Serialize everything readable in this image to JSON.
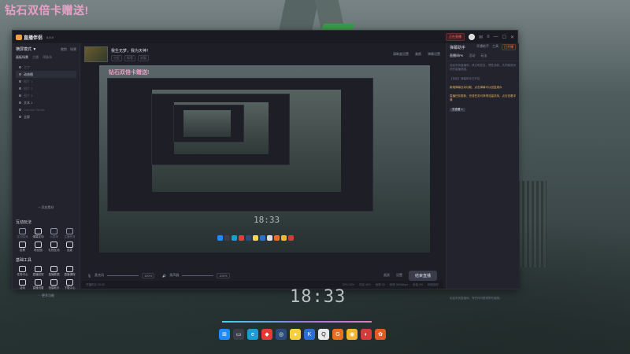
{
  "overlay_watermark": "钻石双倍卡赠送!",
  "desktop_clock": "18:33",
  "app": {
    "name": "直播伴侣",
    "version": "8.5.0",
    "live_badge": "正在直播",
    "sidebar": {
      "mode": "横屏模式 ▼",
      "actions": [
        "裁剪",
        "场景"
      ],
      "tabs": [
        "画板场景",
        "主播",
        "预备场"
      ],
      "scenes": [
        "文字",
        "动态图",
        "图片 1",
        "图片 2",
        "图片 3",
        "文本 1",
        "Chrome Studio",
        "全屏"
      ],
      "add_scene": "+ 添加素材",
      "interact_title": "互动玩法",
      "interact_items": [
        "互动游戏",
        "弹幕互动",
        "小游戏",
        "主播任务",
        "投票",
        "粉丝团",
        "礼物互动",
        "连麦"
      ],
      "tools_title": "基础工具",
      "tool_items": [
        "任务中心",
        "直播回放",
        "直播数据",
        "直播课程",
        "活动",
        "直播设置",
        "拍摄助手",
        "下载中心"
      ],
      "more": "··· 更多功能"
    },
    "toolbar": {
      "stream_title": "我生无梦，我为天神！",
      "tags": [
        "分区",
        "标签",
        "封面"
      ],
      "right": [
        "清晰度设置",
        "美颜",
        "弹幕设置"
      ]
    },
    "preview": {
      "overlay_text": "钻石双倍卡赠送!",
      "clock": "18:33"
    },
    "controls": {
      "mic_label": "麦克风",
      "mic_pct": "100%",
      "speaker_label": "扬声器",
      "speaker_pct": "100%",
      "right_icons": [
        "画质",
        "设置"
      ],
      "go_live": "结束直播"
    },
    "status_bar": {
      "left": "开播时长 00:00",
      "right": [
        "CPU 20%",
        "内存 45%",
        "帧率 30",
        "码率 3000kbps",
        "丢帧 0%",
        "网络良好"
      ]
    },
    "rpanel": {
      "title": "弹幕助手",
      "top_right": [
        "开播助手",
        "工具",
        "已开播"
      ],
      "tabs": [
        "直播间PK",
        "活动",
        "玩法"
      ],
      "messages": [
        {
          "text": "欢迎来到直播间，请文明发言，理性消费，共同营造良好的直播氛围。",
          "hl": false
        },
        {
          "text": "【系统】弹幕助手已开启",
          "hl": false
        },
        {
          "text": "新增弹幕互动功能，点击弹幕可以回复观众",
          "hl": true
        },
        {
          "text": "直播任务更新，完成任务可获得流量扶持，点击查看详情",
          "hl": true
        },
        {
          "text": "去查看 >",
          "hl": false,
          "btn": true
        }
      ],
      "footer": "欢迎来到直播间，有任何问题请联系客服。"
    }
  }
}
